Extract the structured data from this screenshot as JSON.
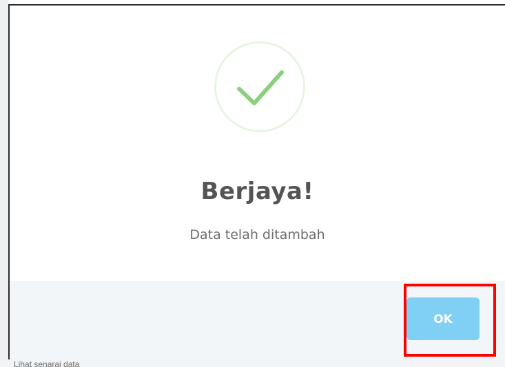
{
  "dialog": {
    "icon": "success-check-icon",
    "title": "Berjaya!",
    "message": "Data telah ditambah",
    "ok_label": "OK"
  },
  "background_page": {
    "peek_text": "Lihat senarai data"
  },
  "colors": {
    "check": "#8bd17c",
    "check_ring": "#e8f4e3",
    "title": "#545454",
    "message": "#6e6e6e",
    "footer_bg": "#f3f6f9",
    "ok_button_bg": "#7fd0f4",
    "ok_button_text": "#ffffff",
    "highlight": "#ff0000"
  }
}
